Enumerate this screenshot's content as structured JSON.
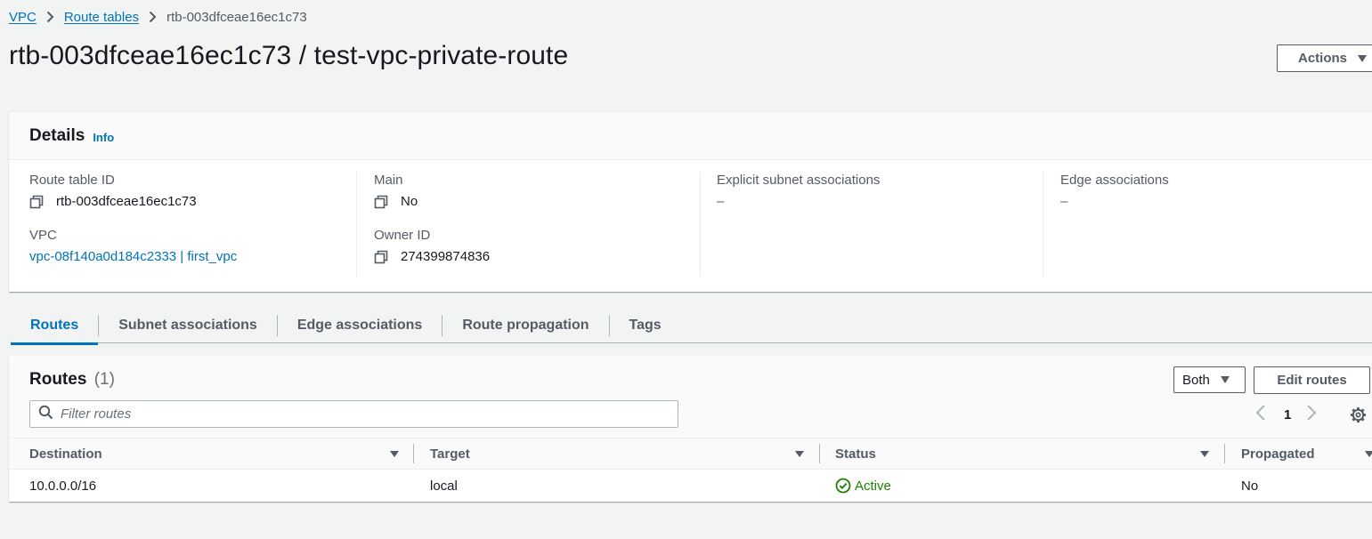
{
  "breadcrumb": {
    "items": [
      {
        "label": "VPC"
      },
      {
        "label": "Route tables"
      }
    ],
    "current": "rtb-003dfceae16ec1c73"
  },
  "page": {
    "title": "rtb-003dfceae16ec1c73 / test-vpc-private-route",
    "actions_label": "Actions"
  },
  "details": {
    "title": "Details",
    "info_label": "Info",
    "route_table_id": {
      "label": "Route table ID",
      "value": "rtb-003dfceae16ec1c73"
    },
    "vpc": {
      "label": "VPC",
      "value": "vpc-08f140a0d184c2333 | first_vpc"
    },
    "main": {
      "label": "Main",
      "value": "No"
    },
    "owner_id": {
      "label": "Owner ID",
      "value": "274399874836"
    },
    "explicit_subnet": {
      "label": "Explicit subnet associations",
      "value": "–"
    },
    "edge_associations": {
      "label": "Edge associations",
      "value": "–"
    }
  },
  "tabs": [
    {
      "label": "Routes",
      "active": true
    },
    {
      "label": "Subnet associations",
      "active": false
    },
    {
      "label": "Edge associations",
      "active": false
    },
    {
      "label": "Route propagation",
      "active": false
    },
    {
      "label": "Tags",
      "active": false
    }
  ],
  "routes": {
    "title": "Routes",
    "count": "(1)",
    "both_label": "Both",
    "edit_label": "Edit routes",
    "filter_placeholder": "Filter routes",
    "filter_value": "",
    "page_number": "1",
    "columns": [
      "Destination",
      "Target",
      "Status",
      "Propagated"
    ],
    "rows": [
      {
        "destination": "10.0.0.0/16",
        "target": "local",
        "status": "Active",
        "propagated": "No"
      }
    ]
  },
  "colors": {
    "link": "#0073bb",
    "active_status": "#1d8102",
    "text": "#16191f",
    "muted": "#545b64"
  }
}
